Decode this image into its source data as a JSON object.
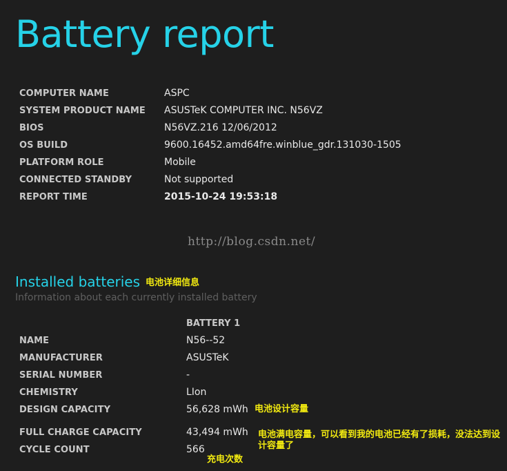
{
  "report": {
    "title": "Battery report",
    "info": [
      {
        "key": "COMPUTER NAME",
        "value": "ASPC"
      },
      {
        "key": "SYSTEM PRODUCT NAME",
        "value": "ASUSTeK COMPUTER INC. N56VZ"
      },
      {
        "key": "BIOS",
        "value": "N56VZ.216 12/06/2012"
      },
      {
        "key": "OS BUILD",
        "value": "9600.16452.amd64fre.winblue_gdr.131030-1505"
      },
      {
        "key": "PLATFORM ROLE",
        "value": "Mobile"
      },
      {
        "key": "CONNECTED STANDBY",
        "value": "Not supported"
      },
      {
        "key": "REPORT TIME",
        "value": "2015-10-24  19:53:18"
      }
    ]
  },
  "watermark": "http://blog.csdn.net/",
  "installed": {
    "title": "Installed batteries",
    "subtitle": "Information about each currently installed battery",
    "annotation": "电池详细信息",
    "battery_header": "BATTERY 1",
    "rows": [
      {
        "key": "NAME",
        "value": "N56--52"
      },
      {
        "key": "MANUFACTURER",
        "value": "ASUSTeK"
      },
      {
        "key": "SERIAL NUMBER",
        "value": "-"
      },
      {
        "key": "CHEMISTRY",
        "value": "LIon"
      },
      {
        "key": "DESIGN CAPACITY",
        "value": "56,628 mWh"
      },
      {
        "key": "FULL CHARGE CAPACITY",
        "value": "43,494 mWh"
      },
      {
        "key": "CYCLE COUNT",
        "value": "566"
      }
    ]
  },
  "annotations": {
    "design_capacity": "电池设计容量",
    "full_charge": "电池满电容量，可以看到我的电池已经有了损耗，没法达到设计容量了",
    "cycle_count": "充电次数"
  },
  "colors": {
    "background": "#1e1e1e",
    "accent": "#26d2e8",
    "annotation": "#f2ea10"
  }
}
